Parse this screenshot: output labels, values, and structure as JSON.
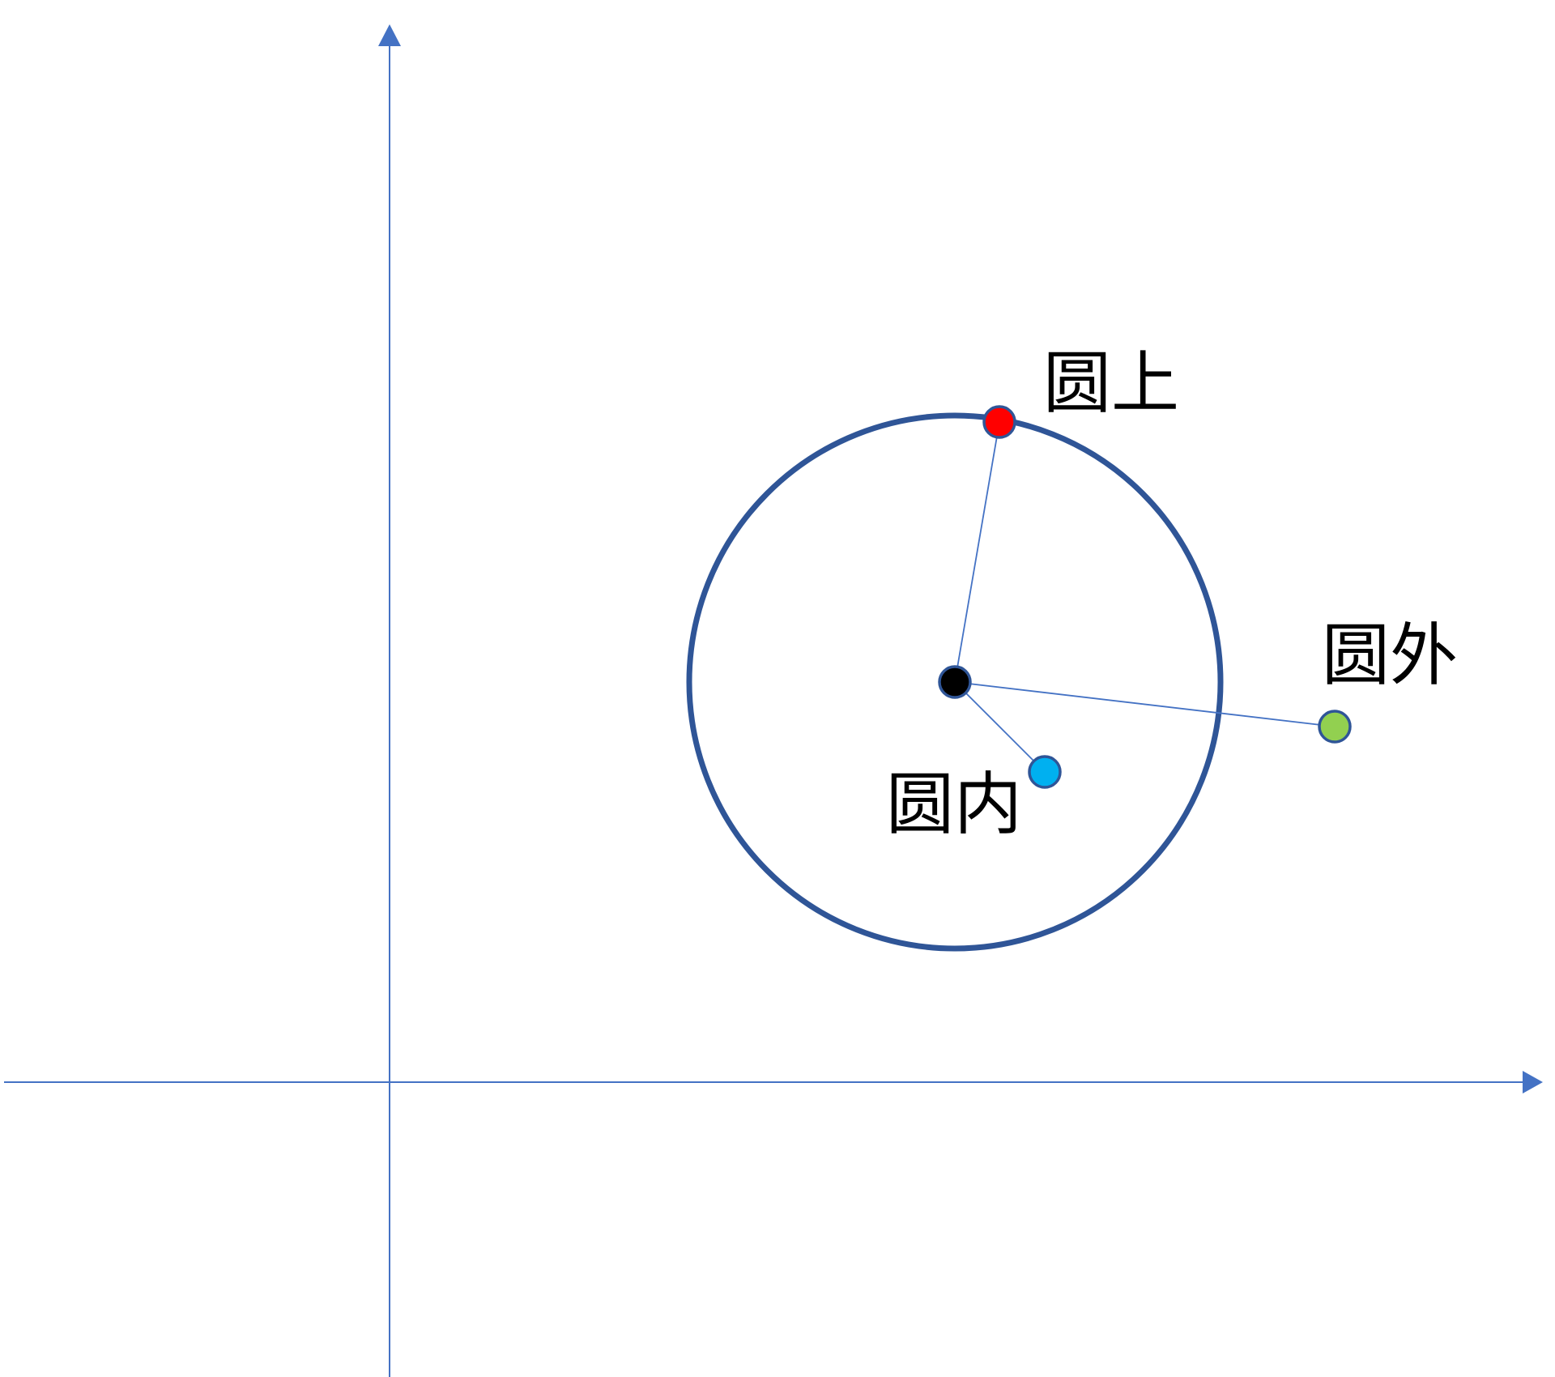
{
  "labels": {
    "on_circle": "圆上",
    "outside": "圆外",
    "inside": "圆内"
  },
  "colors": {
    "axis": "#4472C4",
    "circle": "#2F5597",
    "center_point": "#000000",
    "on_point": "#FF0000",
    "outside_point": "#92D050",
    "inside_point": "#00B0F0",
    "connector": "#4472C4"
  },
  "icons": {
    "x_axis_arrow": "arrowhead-right",
    "y_axis_arrow": "arrowhead-up"
  }
}
